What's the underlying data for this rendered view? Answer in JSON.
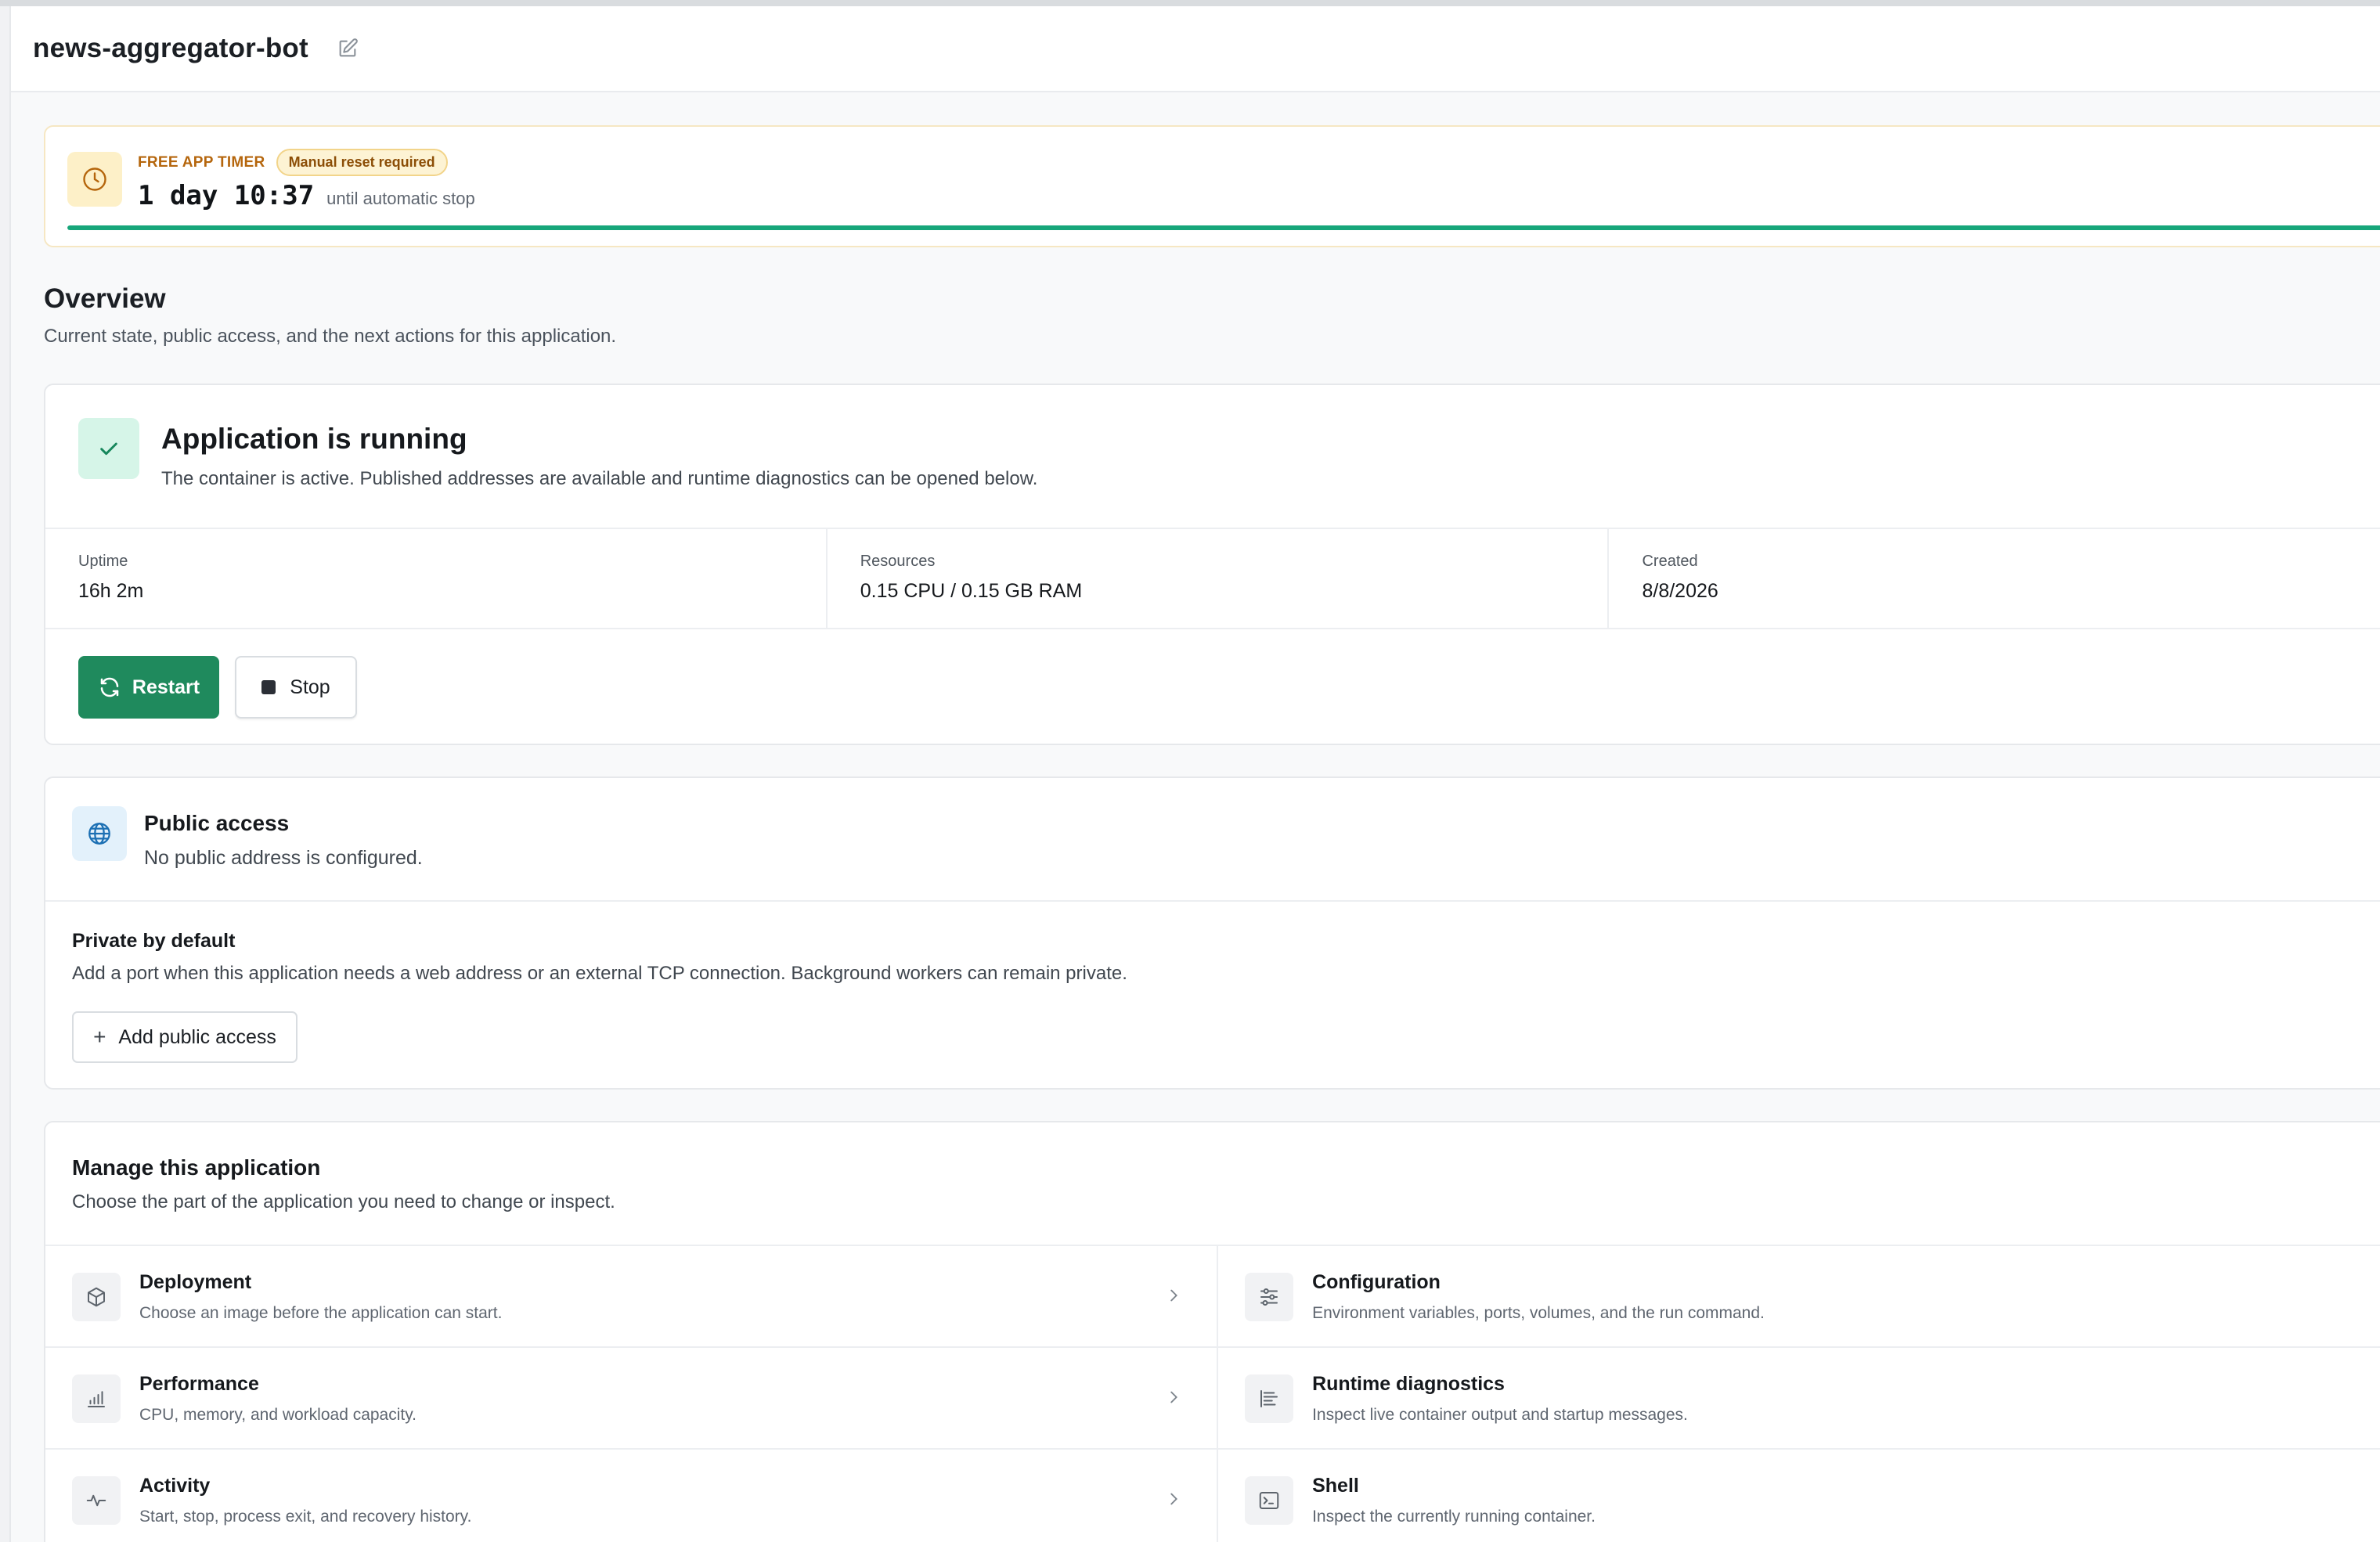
{
  "header": {
    "app_name": "news-aggregator-bot"
  },
  "timer": {
    "label": "FREE APP TIMER",
    "badge": "Manual reset required",
    "time": "1 day 10:37",
    "suffix": "until automatic stop",
    "progress": 1.0
  },
  "overview": {
    "title": "Overview",
    "subtitle": "Current state, public access, and the next actions for this application."
  },
  "status": {
    "title": "Application is running",
    "description": "The container is active. Published addresses are available and runtime diagnostics can be opened below.",
    "stats": [
      {
        "label": "Uptime",
        "value": "16h 2m"
      },
      {
        "label": "Resources",
        "value": "0.15 CPU / 0.15 GB RAM"
      },
      {
        "label": "Created",
        "value": "8/8/2026"
      }
    ],
    "restart_label": "Restart",
    "stop_label": "Stop"
  },
  "public_access": {
    "title": "Public access",
    "description": "No public address is configured.",
    "private_title": "Private by default",
    "private_description": "Add a port when this application needs a web address or an external TCP connection. Background workers can remain private.",
    "add_label": "Add public access"
  },
  "manage": {
    "title": "Manage this application",
    "subtitle": "Choose the part of the application you need to change or inspect.",
    "items": [
      {
        "label": "Deployment",
        "description": "Choose an image before the application can start.",
        "icon": "box-icon"
      },
      {
        "label": "Configuration",
        "description": "Environment variables, ports, volumes, and the run command.",
        "icon": "sliders-icon"
      },
      {
        "label": "Performance",
        "description": "CPU, memory, and workload capacity.",
        "icon": "bar-chart-icon"
      },
      {
        "label": "Runtime diagnostics",
        "description": "Inspect live container output and startup messages.",
        "icon": "logs-icon"
      },
      {
        "label": "Activity",
        "description": "Start, stop, process exit, and recovery history.",
        "icon": "activity-icon"
      },
      {
        "label": "Shell",
        "description": "Inspect the currently running container.",
        "icon": "terminal-icon"
      }
    ]
  },
  "colors": {
    "accent": "#1f8a5d",
    "timer_bar": "#17a67a",
    "warning": "#b5660d"
  }
}
